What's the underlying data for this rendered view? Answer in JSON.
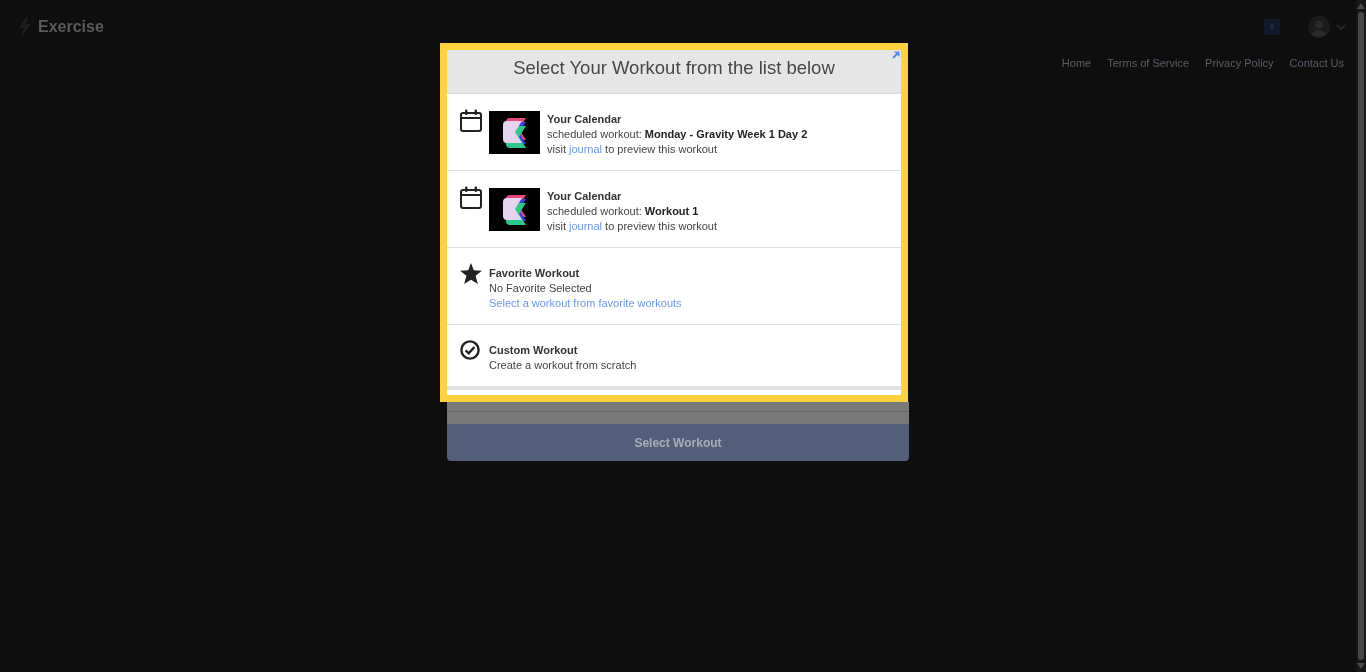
{
  "header": {
    "brand": "Exercise",
    "nav": [
      "Home",
      "Terms of Service",
      "Privacy Policy",
      "Contact Us"
    ]
  },
  "dialog": {
    "title": "Select Your Workout from the list below",
    "options": [
      {
        "kind": "calendar",
        "title": "Your Calendar",
        "detail": "scheduled workout: **Monday - Gravity Week 1 Day 2**",
        "note": {
          "before": "visit",
          "link": "journal",
          "after": "to preview this workout"
        }
      },
      {
        "kind": "calendar",
        "title": "Your Calendar",
        "detail": "scheduled workout: **Workout 1**",
        "note": {
          "before": "visit",
          "link": "journal",
          "after": "to preview this workout"
        }
      },
      {
        "kind": "favorite",
        "title": "Favorite Workout",
        "text": "No Favorite Selected",
        "link": "Select a workout from favorite workouts"
      },
      {
        "kind": "custom",
        "title": "Custom Workout",
        "text": "Create a workout from scratch"
      }
    ],
    "button": "Select Workout"
  }
}
